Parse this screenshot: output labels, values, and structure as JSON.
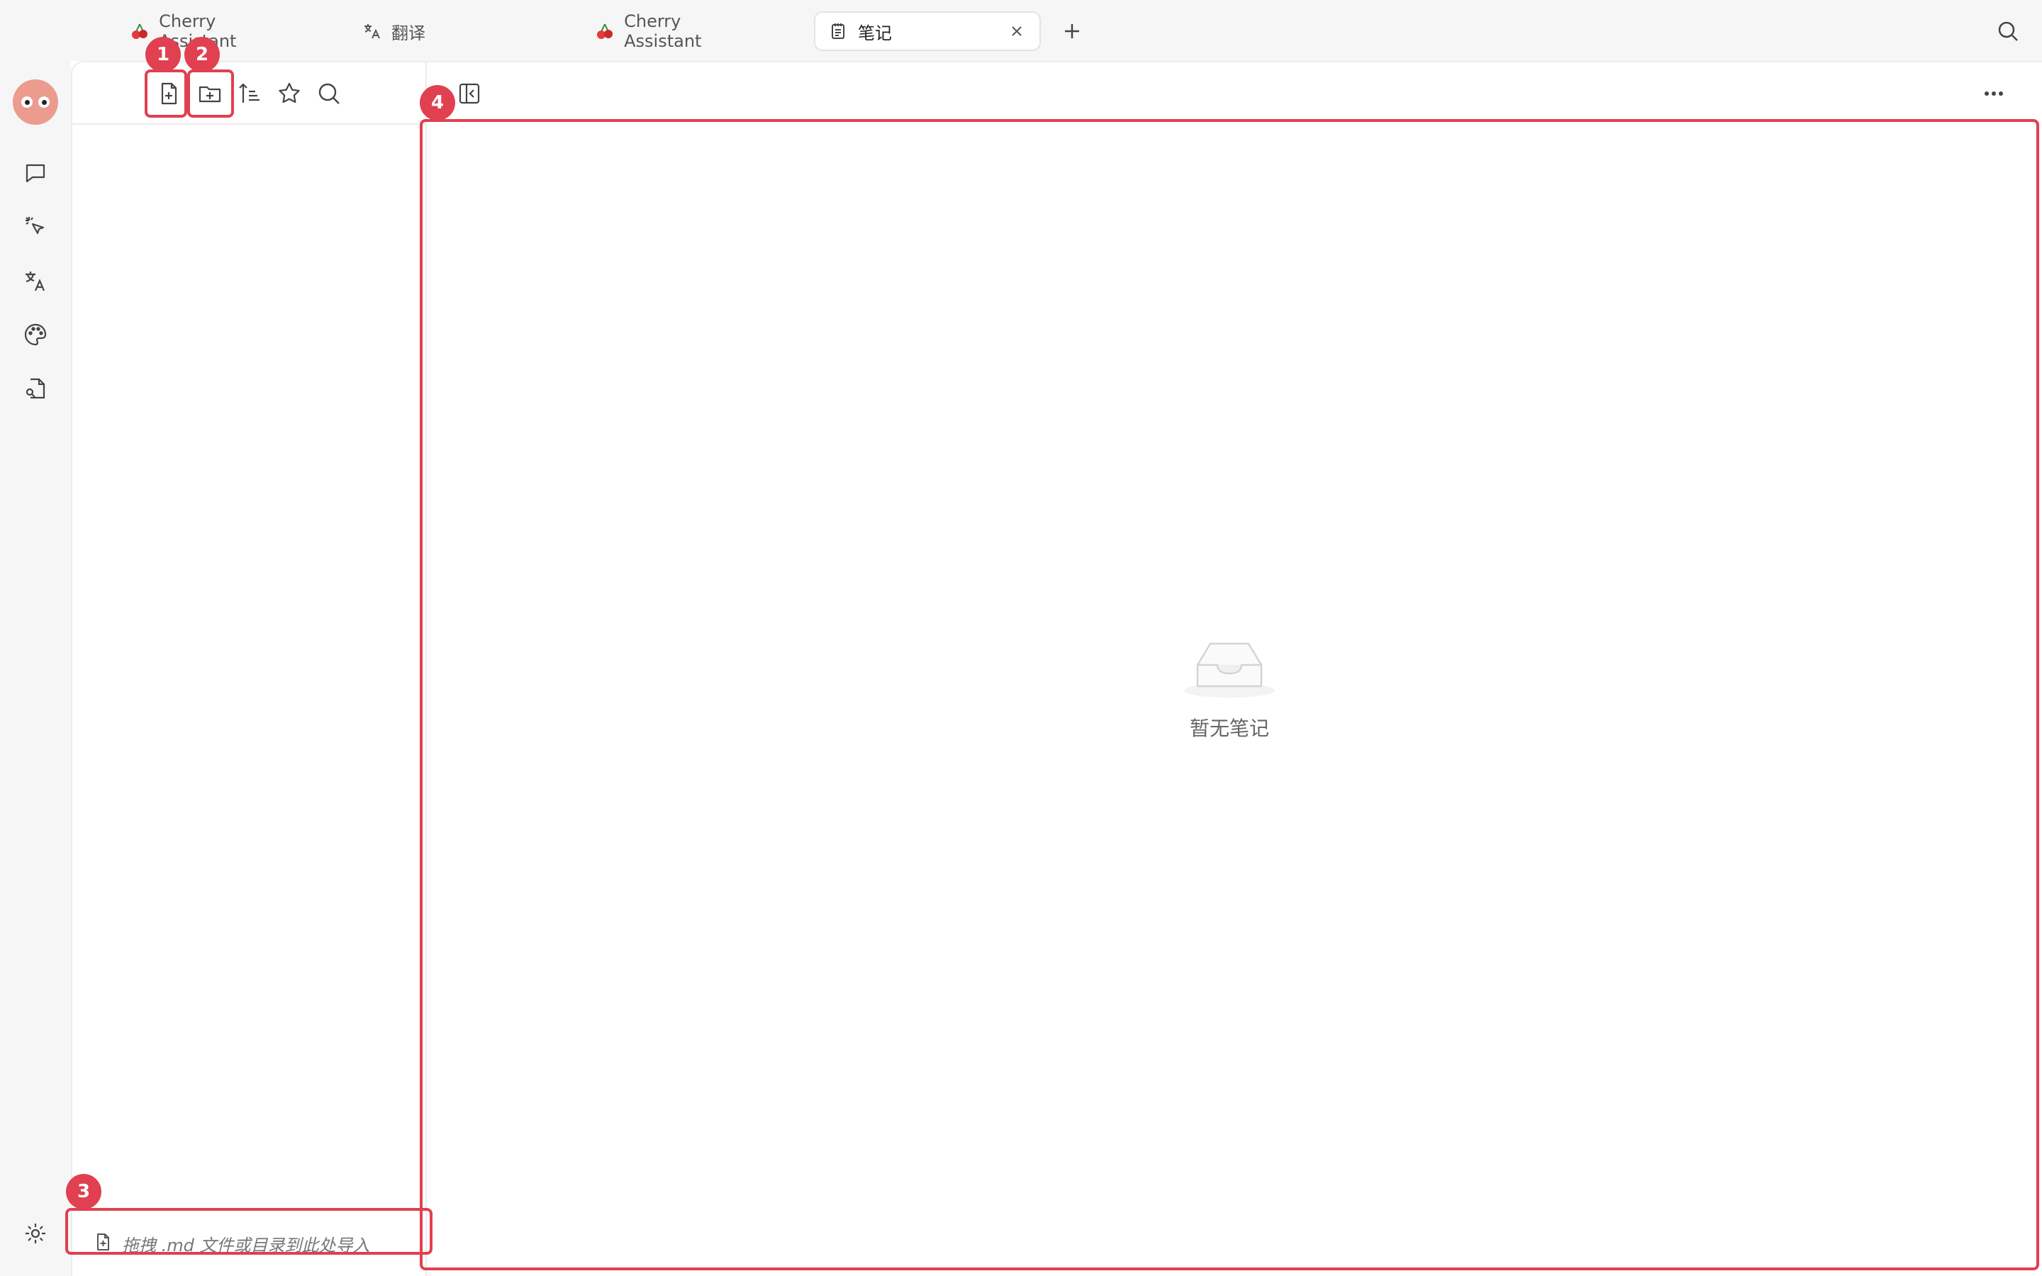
{
  "tabs": [
    {
      "label": "Cherry Assistant",
      "icon": "cherry-icon"
    },
    {
      "label": "翻译",
      "icon": "translate-icon"
    },
    {
      "label": "Cherry Assistant",
      "icon": "cherry-icon"
    },
    {
      "label": "笔记",
      "icon": "notepad-icon",
      "active": true
    }
  ],
  "rail": {
    "items": [
      "chat-icon",
      "sparkle-cursor-icon",
      "translate-icon",
      "palette-icon",
      "file-search-icon"
    ],
    "bottom": "settings-icon"
  },
  "notes_toolbar": [
    "new-note-icon",
    "new-folder-icon",
    "sort-icon",
    "star-icon",
    "search-icon"
  ],
  "import_hint": "拖拽 .md 文件或目录到此处导入",
  "empty_state": {
    "label": "暂无笔记",
    "icon": "empty-inbox-icon"
  },
  "annotations": [
    {
      "label": "1",
      "target": "new-note-button"
    },
    {
      "label": "2",
      "target": "new-folder-button"
    },
    {
      "label": "3",
      "target": "import-drop-zone"
    },
    {
      "label": "4",
      "target": "note-editor-area"
    }
  ],
  "colors": {
    "annotation": "#e0404f",
    "background": "#f6f6f6",
    "avatar": "#ec9b8f"
  }
}
